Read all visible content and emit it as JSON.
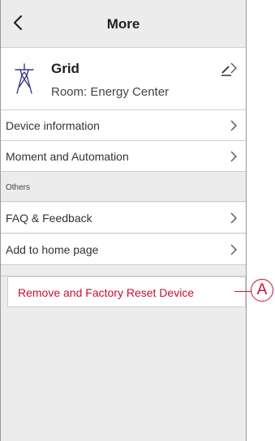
{
  "header": {
    "title": "More",
    "back_icon": "chevron-left-icon"
  },
  "device": {
    "name": "Grid",
    "room": "Room: Energy Center",
    "icon": "power-pylon-icon",
    "edit_icon": "pencil-icon"
  },
  "menu": {
    "device_information": "Device information",
    "moment_automation": "Moment and Automation"
  },
  "others": {
    "section_title": "Others",
    "faq": "FAQ & Feedback",
    "add_home": "Add to home page"
  },
  "remove": {
    "label": "Remove and Factory Reset Device",
    "color": "#c8102e"
  },
  "callout": {
    "label": "A"
  }
}
